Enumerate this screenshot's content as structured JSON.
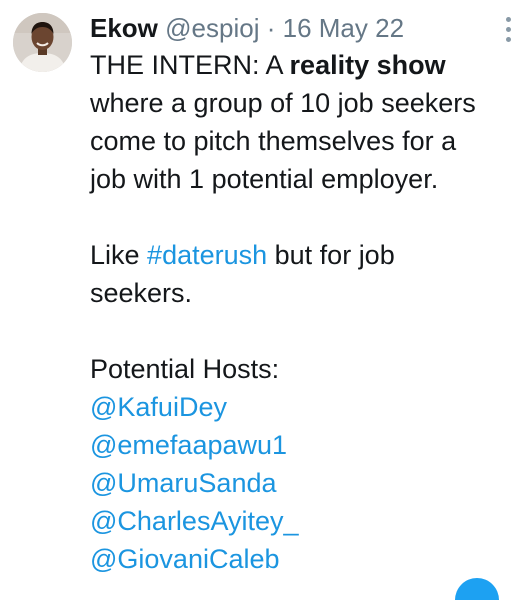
{
  "tweet": {
    "author_name": "Ekow",
    "author_handle": "@espioj",
    "separator": "·",
    "date": "16 May 22",
    "text": {
      "line1_prefix": "THE INTERN: A ",
      "line1_bold": "reality show",
      "line2": "where a group of 10 job seekers",
      "line3": "come to pitch themselves for a",
      "line4": "job with 1 potential employer.",
      "line5_prefix": "Like ",
      "line5_hashtag": "#daterush",
      "line5_suffix": " but for job",
      "line6": "seekers.",
      "hosts_label": "Potential Hosts:",
      "mentions": [
        "@KafuiDey",
        "@emefaapawu1",
        "@UmaruSanda",
        "@CharlesAyitey_",
        "@GiovaniCaleb"
      ]
    }
  },
  "icons": {
    "more": "more-vertical-icon",
    "avatar": "user-avatar"
  },
  "colors": {
    "text": "#14171a",
    "meta": "#657786",
    "link": "#1b95e0"
  }
}
